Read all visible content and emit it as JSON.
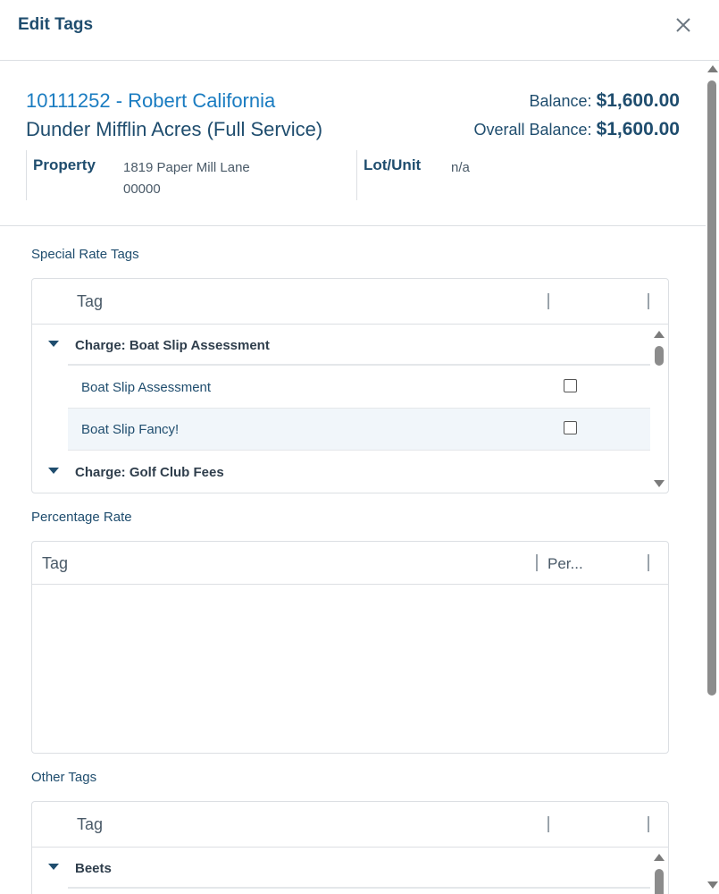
{
  "modal": {
    "title": "Edit Tags",
    "close_icon": "close-icon"
  },
  "account": {
    "id_name": "10111252 - Robert California",
    "name": "Dunder Mifflin Acres (Full Service)",
    "balance_label": "Balance:",
    "balance_value": "$1,600.00",
    "overall_label": "Overall Balance:",
    "overall_value": "$1,600.00",
    "property_label": "Property",
    "property_line1": "1819 Paper Mill Lane",
    "property_line2": "00000",
    "lot_label": "Lot/Unit",
    "lot_value": "n/a"
  },
  "special_rate": {
    "label": "Special Rate Tags",
    "col_tag": "Tag",
    "groups": [
      {
        "title": "Charge: Boat Slip Assessment"
      },
      {
        "title": "Charge: Golf Club Fees"
      }
    ],
    "items": [
      {
        "label": "Boat Slip Assessment",
        "checked": false
      },
      {
        "label": "Boat Slip Fancy!",
        "checked": false
      }
    ]
  },
  "percentage_rate": {
    "label": "Percentage Rate",
    "col_tag": "Tag",
    "col_percent": "Per..."
  },
  "other_tags": {
    "label": "Other Tags",
    "col_tag": "Tag",
    "groups": [
      {
        "title": "Beets"
      }
    ]
  },
  "colors": {
    "brand_dark": "#1f4d6e",
    "link_blue": "#1a7cc1",
    "row_highlight": "#f1f6fa"
  }
}
